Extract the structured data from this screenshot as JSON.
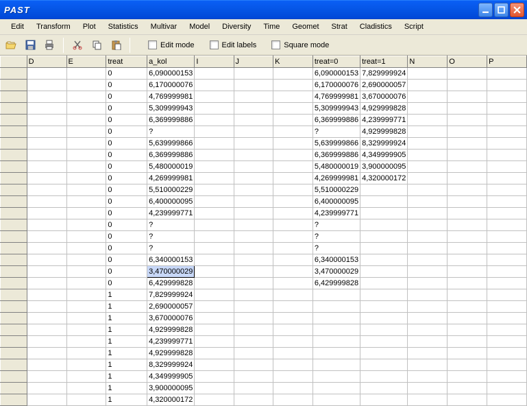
{
  "app_title": "PAST",
  "menu": [
    "Edit",
    "Transform",
    "Plot",
    "Statistics",
    "Multivar",
    "Model",
    "Diversity",
    "Time",
    "Geomet",
    "Strat",
    "Cladistics",
    "Script"
  ],
  "toolbar_labels": {
    "edit_mode": "Edit mode",
    "edit_labels": "Edit labels",
    "square_mode": "Square mode"
  },
  "columns": [
    "",
    "D",
    "E",
    "treat",
    "a_kol",
    "I",
    "J",
    "K",
    "treat=0",
    "treat=1",
    "N",
    "O",
    "P"
  ],
  "selected_cell": {
    "row": 18,
    "col": 4
  },
  "rows": [
    {
      "D": "",
      "E": "",
      "treat": "0",
      "a_kol": "6,090000153",
      "I": "",
      "J": "",
      "K": "",
      "treat0": "6,090000153",
      "treat1": "7,829999924",
      "N": "",
      "O": "",
      "P": ""
    },
    {
      "D": "",
      "E": "",
      "treat": "0",
      "a_kol": "6,170000076",
      "I": "",
      "J": "",
      "K": "",
      "treat0": "6,170000076",
      "treat1": "2,690000057",
      "N": "",
      "O": "",
      "P": ""
    },
    {
      "D": "",
      "E": "",
      "treat": "0",
      "a_kol": "4,769999981",
      "I": "",
      "J": "",
      "K": "",
      "treat0": "4,769999981",
      "treat1": "3,670000076",
      "N": "",
      "O": "",
      "P": ""
    },
    {
      "D": "",
      "E": "",
      "treat": "0",
      "a_kol": "5,309999943",
      "I": "",
      "J": "",
      "K": "",
      "treat0": "5,309999943",
      "treat1": "4,929999828",
      "N": "",
      "O": "",
      "P": ""
    },
    {
      "D": "",
      "E": "",
      "treat": "0",
      "a_kol": "6,369999886",
      "I": "",
      "J": "",
      "K": "",
      "treat0": "6,369999886",
      "treat1": "4,239999771",
      "N": "",
      "O": "",
      "P": ""
    },
    {
      "D": "",
      "E": "",
      "treat": "0",
      "a_kol": "?",
      "I": "",
      "J": "",
      "K": "",
      "treat0": "?",
      "treat1": "4,929999828",
      "N": "",
      "O": "",
      "P": ""
    },
    {
      "D": "",
      "E": "",
      "treat": "0",
      "a_kol": "5,639999866",
      "I": "",
      "J": "",
      "K": "",
      "treat0": "5,639999866",
      "treat1": "8,329999924",
      "N": "",
      "O": "",
      "P": ""
    },
    {
      "D": "",
      "E": "",
      "treat": "0",
      "a_kol": "6,369999886",
      "I": "",
      "J": "",
      "K": "",
      "treat0": "6,369999886",
      "treat1": "4,349999905",
      "N": "",
      "O": "",
      "P": ""
    },
    {
      "D": "",
      "E": "",
      "treat": "0",
      "a_kol": "5,480000019",
      "I": "",
      "J": "",
      "K": "",
      "treat0": "5,480000019",
      "treat1": "3,900000095",
      "N": "",
      "O": "",
      "P": ""
    },
    {
      "D": "",
      "E": "",
      "treat": "0",
      "a_kol": "4,269999981",
      "I": "",
      "J": "",
      "K": "",
      "treat0": "4,269999981",
      "treat1": "4,320000172",
      "N": "",
      "O": "",
      "P": ""
    },
    {
      "D": "",
      "E": "",
      "treat": "0",
      "a_kol": "5,510000229",
      "I": "",
      "J": "",
      "K": "",
      "treat0": "5,510000229",
      "treat1": "",
      "N": "",
      "O": "",
      "P": ""
    },
    {
      "D": "",
      "E": "",
      "treat": "0",
      "a_kol": "6,400000095",
      "I": "",
      "J": "",
      "K": "",
      "treat0": "6,400000095",
      "treat1": "",
      "N": "",
      "O": "",
      "P": ""
    },
    {
      "D": "",
      "E": "",
      "treat": "0",
      "a_kol": "4,239999771",
      "I": "",
      "J": "",
      "K": "",
      "treat0": "4,239999771",
      "treat1": "",
      "N": "",
      "O": "",
      "P": ""
    },
    {
      "D": "",
      "E": "",
      "treat": "0",
      "a_kol": "?",
      "I": "",
      "J": "",
      "K": "",
      "treat0": "?",
      "treat1": "",
      "N": "",
      "O": "",
      "P": ""
    },
    {
      "D": "",
      "E": "",
      "treat": "0",
      "a_kol": "?",
      "I": "",
      "J": "",
      "K": "",
      "treat0": "?",
      "treat1": "",
      "N": "",
      "O": "",
      "P": ""
    },
    {
      "D": "",
      "E": "",
      "treat": "0",
      "a_kol": "?",
      "I": "",
      "J": "",
      "K": "",
      "treat0": "?",
      "treat1": "",
      "N": "",
      "O": "",
      "P": ""
    },
    {
      "D": "",
      "E": "",
      "treat": "0",
      "a_kol": "6,340000153",
      "I": "",
      "J": "",
      "K": "",
      "treat0": "6,340000153",
      "treat1": "",
      "N": "",
      "O": "",
      "P": ""
    },
    {
      "D": "",
      "E": "",
      "treat": "0",
      "a_kol": "3,470000029",
      "I": "",
      "J": "",
      "K": "",
      "treat0": "3,470000029",
      "treat1": "",
      "N": "",
      "O": "",
      "P": ""
    },
    {
      "D": "",
      "E": "",
      "treat": "0",
      "a_kol": "6,429999828",
      "I": "",
      "J": "",
      "K": "",
      "treat0": "6,429999828",
      "treat1": "",
      "N": "",
      "O": "",
      "P": ""
    },
    {
      "D": "",
      "E": "",
      "treat": "1",
      "a_kol": "7,829999924",
      "I": "",
      "J": "",
      "K": "",
      "treat0": "",
      "treat1": "",
      "N": "",
      "O": "",
      "P": ""
    },
    {
      "D": "",
      "E": "",
      "treat": "1",
      "a_kol": "2,690000057",
      "I": "",
      "J": "",
      "K": "",
      "treat0": "",
      "treat1": "",
      "N": "",
      "O": "",
      "P": ""
    },
    {
      "D": "",
      "E": "",
      "treat": "1",
      "a_kol": "3,670000076",
      "I": "",
      "J": "",
      "K": "",
      "treat0": "",
      "treat1": "",
      "N": "",
      "O": "",
      "P": ""
    },
    {
      "D": "",
      "E": "",
      "treat": "1",
      "a_kol": "4,929999828",
      "I": "",
      "J": "",
      "K": "",
      "treat0": "",
      "treat1": "",
      "N": "",
      "O": "",
      "P": ""
    },
    {
      "D": "",
      "E": "",
      "treat": "1",
      "a_kol": "4,239999771",
      "I": "",
      "J": "",
      "K": "",
      "treat0": "",
      "treat1": "",
      "N": "",
      "O": "",
      "P": ""
    },
    {
      "D": "",
      "E": "",
      "treat": "1",
      "a_kol": "4,929999828",
      "I": "",
      "J": "",
      "K": "",
      "treat0": "",
      "treat1": "",
      "N": "",
      "O": "",
      "P": ""
    },
    {
      "D": "",
      "E": "",
      "treat": "1",
      "a_kol": "8,329999924",
      "I": "",
      "J": "",
      "K": "",
      "treat0": "",
      "treat1": "",
      "N": "",
      "O": "",
      "P": ""
    },
    {
      "D": "",
      "E": "",
      "treat": "1",
      "a_kol": "4,349999905",
      "I": "",
      "J": "",
      "K": "",
      "treat0": "",
      "treat1": "",
      "N": "",
      "O": "",
      "P": ""
    },
    {
      "D": "",
      "E": "",
      "treat": "1",
      "a_kol": "3,900000095",
      "I": "",
      "J": "",
      "K": "",
      "treat0": "",
      "treat1": "",
      "N": "",
      "O": "",
      "P": ""
    },
    {
      "D": "",
      "E": "",
      "treat": "1",
      "a_kol": "4,320000172",
      "I": "",
      "J": "",
      "K": "",
      "treat0": "",
      "treat1": "",
      "N": "",
      "O": "",
      "P": ""
    }
  ]
}
